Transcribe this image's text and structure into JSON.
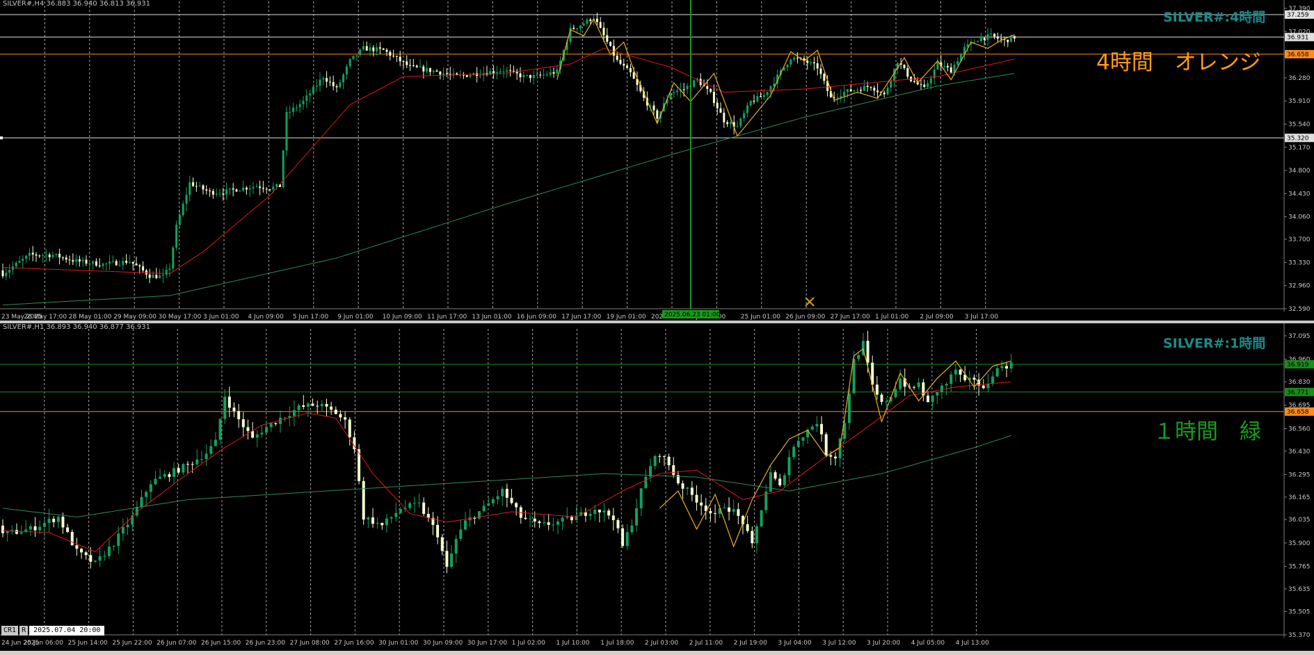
{
  "colors": {
    "bg": "#000000",
    "grid": "#d0d0d0",
    "bull": "#14a060",
    "bear": "#f5ffd0",
    "ma_red": "#e01818",
    "ma_green": "#2e8b57",
    "zigzag": "#e8b020",
    "orange_line": "#ff8c1a",
    "green_line": "#1a8c1a",
    "white_line": "#e0e0e0",
    "axis_text": "#c8c8c8",
    "watermark": "#1c8a8a",
    "note_orange": "#ff9a1a",
    "note_green": "#1a9a1a",
    "vline": "#1a9a1a",
    "cross_marker": "#d8a020"
  },
  "h4": {
    "header": "SILVER#,H4  36.883 36.940 36.813 36.931",
    "watermark": "SILVER#:4時間",
    "note": "4時間　オレンジ",
    "hlines": [
      {
        "price": 37.29,
        "label": "37.259",
        "color": "white_line"
      },
      {
        "price": 36.931,
        "label": "36.931",
        "color": "white_line"
      },
      {
        "price": 36.658,
        "label": "36.658",
        "color": "orange_line"
      },
      {
        "price": 35.32,
        "label": "35.320",
        "color": "white_line"
      }
    ],
    "vline_date_label": "2025.06.23 01:00",
    "chart_data": {
      "type": "candlestick",
      "symbol": "SILVER#",
      "timeframe": "H4",
      "ylim": [
        32.59,
        37.39
      ],
      "yticks": [
        "37.390",
        "37.020",
        "36.650",
        "36.280",
        "35.910",
        "35.540",
        "35.170",
        "34.800",
        "34.430",
        "34.060",
        "33.700",
        "33.330",
        "32.960",
        "32.590"
      ],
      "xlabels": [
        "23 May 2025",
        "26 May 17:00",
        "28 May 01:00",
        "29 May 09:00",
        "30 May 17:00",
        "3 Jun 01:00",
        "4 Jun 09:00",
        "5 Jun 17:00",
        "9 Jun 01:00",
        "10 Jun 09:00",
        "11 Jun 17:00",
        "13 Jun 01:00",
        "16 Jun 09:00",
        "17 Jun 17:00",
        "19 Jun 01:00",
        "2025.06.23 01:00",
        "Jun 17:00",
        "25 Jun 01:00",
        "26 Jun 09:00",
        "27 Jun 17:00",
        "1 Jul 01:00",
        "2 Jul 09:00",
        "3 Jul 17:00"
      ],
      "key_closes": [
        [
          0,
          33.15
        ],
        [
          8,
          33.45
        ],
        [
          15,
          33.45
        ],
        [
          22,
          33.35
        ],
        [
          30,
          33.3
        ],
        [
          38,
          33.35
        ],
        [
          44,
          33.12
        ],
        [
          48,
          33.1
        ],
        [
          50,
          33.25
        ],
        [
          52,
          33.9
        ],
        [
          56,
          34.6
        ],
        [
          62,
          34.45
        ],
        [
          66,
          34.45
        ],
        [
          70,
          34.5
        ],
        [
          76,
          34.55
        ],
        [
          80,
          34.52
        ],
        [
          83,
          34.55
        ],
        [
          85,
          35.7
        ],
        [
          90,
          35.9
        ],
        [
          96,
          36.3
        ],
        [
          100,
          36.1
        ],
        [
          104,
          36.55
        ],
        [
          108,
          36.75
        ],
        [
          114,
          36.72
        ],
        [
          122,
          36.45
        ],
        [
          130,
          36.38
        ],
        [
          136,
          36.3
        ],
        [
          142,
          36.35
        ],
        [
          150,
          36.4
        ],
        [
          156,
          36.3
        ],
        [
          160,
          36.3
        ],
        [
          166,
          36.38
        ],
        [
          170,
          37.05
        ],
        [
          174,
          37.15
        ],
        [
          177,
          37.25
        ],
        [
          180,
          36.95
        ],
        [
          184,
          36.55
        ],
        [
          188,
          36.35
        ],
        [
          192,
          35.95
        ],
        [
          196,
          35.65
        ],
        [
          200,
          36.05
        ],
        [
          204,
          36.1
        ],
        [
          208,
          36.25
        ],
        [
          212,
          36.02
        ],
        [
          216,
          35.6
        ],
        [
          220,
          35.5
        ],
        [
          224,
          35.9
        ],
        [
          228,
          36.0
        ],
        [
          232,
          36.3
        ],
        [
          236,
          36.6
        ],
        [
          240,
          36.55
        ],
        [
          244,
          36.45
        ],
        [
          248,
          35.95
        ],
        [
          252,
          36.05
        ],
        [
          256,
          36.1
        ],
        [
          260,
          36.15
        ],
        [
          264,
          36.0
        ],
        [
          268,
          36.55
        ],
        [
          272,
          36.25
        ],
        [
          276,
          36.1
        ],
        [
          280,
          36.5
        ],
        [
          284,
          36.4
        ],
        [
          288,
          36.75
        ],
        [
          292,
          36.9
        ],
        [
          296,
          36.95
        ],
        [
          300,
          36.87
        ],
        [
          303,
          36.93
        ]
      ],
      "ma_fast_sample": [
        [
          0,
          33.25
        ],
        [
          50,
          33.15
        ],
        [
          60,
          33.5
        ],
        [
          80,
          34.4
        ],
        [
          104,
          35.85
        ],
        [
          120,
          36.3
        ],
        [
          150,
          36.35
        ],
        [
          170,
          36.5
        ],
        [
          180,
          36.75
        ],
        [
          200,
          36.45
        ],
        [
          216,
          36.05
        ],
        [
          240,
          36.1
        ],
        [
          260,
          36.2
        ],
        [
          280,
          36.3
        ],
        [
          303,
          36.58
        ]
      ],
      "ma_slow_sample": [
        [
          0,
          32.65
        ],
        [
          50,
          32.8
        ],
        [
          100,
          33.4
        ],
        [
          150,
          34.25
        ],
        [
          200,
          35.05
        ],
        [
          240,
          35.65
        ],
        [
          280,
          36.15
        ],
        [
          303,
          36.35
        ]
      ],
      "zigzag": [
        [
          166,
          36.25
        ],
        [
          170,
          37.05
        ],
        [
          174,
          36.95
        ],
        [
          177,
          37.22
        ],
        [
          182,
          36.65
        ],
        [
          186,
          36.85
        ],
        [
          189,
          36.4
        ],
        [
          196,
          35.55
        ],
        [
          201,
          36.2
        ],
        [
          206,
          35.9
        ],
        [
          213,
          36.35
        ],
        [
          220,
          35.35
        ],
        [
          230,
          36.0
        ],
        [
          236,
          36.7
        ],
        [
          240,
          36.55
        ],
        [
          244,
          36.72
        ],
        [
          249,
          35.92
        ],
        [
          256,
          36.05
        ],
        [
          262,
          35.95
        ],
        [
          270,
          36.6
        ],
        [
          274,
          36.2
        ],
        [
          280,
          36.55
        ],
        [
          284,
          36.25
        ],
        [
          290,
          36.85
        ],
        [
          295,
          36.75
        ],
        [
          299,
          36.88
        ],
        [
          303,
          36.97
        ]
      ]
    }
  },
  "h1": {
    "header": "SILVER#,H1  36.893 36.940 36.877 36.931",
    "watermark": "SILVER#:1時間",
    "note": "１時間　緑",
    "hlines": [
      {
        "price": 36.931,
        "label": "36.919",
        "color": "green_line"
      },
      {
        "price": 36.771,
        "label": "36.771",
        "color": "green_line"
      },
      {
        "price": 36.658,
        "label": "36.658",
        "color": "orange_line"
      }
    ],
    "chart_data": {
      "type": "candlestick",
      "symbol": "SILVER#",
      "timeframe": "H1",
      "ylim": [
        35.37,
        37.095
      ],
      "yticks": [
        "37.095",
        "36.960",
        "36.830",
        "36.695",
        "36.560",
        "36.430",
        "36.295",
        "36.165",
        "36.035",
        "35.900",
        "35.765",
        "35.635",
        "35.505",
        "35.370"
      ],
      "xlabels": [
        "24 Jun 2025",
        "25 Jun 06:00",
        "25 Jun 14:00",
        "25 Jun 22:00",
        "26 Jun 07:00",
        "26 Jun 15:00",
        "26 Jun 23:00",
        "27 Jun 08:00",
        "27 Jun 16:00",
        "30 Jun 01:00",
        "30 Jun 09:00",
        "30 Jun 17:00",
        "1 Jul 02:00",
        "1 Jul 10:00",
        "1 Jul 18:00",
        "2 Jul 03:00",
        "2 Jul 11:00",
        "2 Jul 19:00",
        "3 Jul 04:00",
        "3 Jul 12:00",
        "3 Jul 20:00",
        "4 Jul 05:00",
        "4 Jul 13:00"
      ],
      "key_closes": [
        [
          0,
          35.95
        ],
        [
          6,
          35.98
        ],
        [
          12,
          36.05
        ],
        [
          16,
          35.85
        ],
        [
          20,
          35.78
        ],
        [
          24,
          35.9
        ],
        [
          28,
          36.05
        ],
        [
          32,
          36.25
        ],
        [
          36,
          36.3
        ],
        [
          40,
          36.35
        ],
        [
          44,
          36.42
        ],
        [
          46,
          36.48
        ],
        [
          48,
          36.75
        ],
        [
          50,
          36.65
        ],
        [
          54,
          36.5
        ],
        [
          56,
          36.55
        ],
        [
          60,
          36.62
        ],
        [
          64,
          36.68
        ],
        [
          68,
          36.7
        ],
        [
          72,
          36.65
        ],
        [
          74,
          36.6
        ],
        [
          76,
          36.45
        ],
        [
          78,
          36.05
        ],
        [
          82,
          36.0
        ],
        [
          86,
          36.1
        ],
        [
          90,
          36.12
        ],
        [
          94,
          35.95
        ],
        [
          96,
          35.75
        ],
        [
          98,
          35.92
        ],
        [
          100,
          36.02
        ],
        [
          104,
          36.1
        ],
        [
          108,
          36.2
        ],
        [
          112,
          36.05
        ],
        [
          116,
          36.0
        ],
        [
          120,
          36.02
        ],
        [
          124,
          36.05
        ],
        [
          128,
          36.1
        ],
        [
          132,
          36.05
        ],
        [
          134,
          35.88
        ],
        [
          136,
          36.02
        ],
        [
          138,
          36.2
        ],
        [
          140,
          36.35
        ],
        [
          142,
          36.42
        ],
        [
          144,
          36.35
        ],
        [
          146,
          36.25
        ],
        [
          148,
          36.2
        ],
        [
          150,
          36.15
        ],
        [
          152,
          36.1
        ],
        [
          154,
          36.05
        ],
        [
          156,
          36.12
        ],
        [
          158,
          36.08
        ],
        [
          160,
          36.02
        ],
        [
          162,
          35.88
        ],
        [
          164,
          36.1
        ],
        [
          166,
          36.3
        ],
        [
          168,
          36.22
        ],
        [
          170,
          36.4
        ],
        [
          172,
          36.5
        ],
        [
          174,
          36.55
        ],
        [
          176,
          36.6
        ],
        [
          178,
          36.42
        ],
        [
          180,
          36.4
        ],
        [
          182,
          36.6
        ],
        [
          184,
          36.95
        ],
        [
          186,
          37.05
        ],
        [
          188,
          36.8
        ],
        [
          190,
          36.7
        ],
        [
          192,
          36.75
        ],
        [
          194,
          36.85
        ],
        [
          196,
          36.78
        ],
        [
          198,
          36.82
        ],
        [
          200,
          36.7
        ],
        [
          202,
          36.78
        ],
        [
          204,
          36.82
        ],
        [
          206,
          36.9
        ],
        [
          208,
          36.82
        ],
        [
          210,
          36.85
        ],
        [
          212,
          36.78
        ],
        [
          214,
          36.88
        ],
        [
          216,
          36.92
        ],
        [
          218,
          36.93
        ]
      ],
      "ma_fast_sample": [
        [
          0,
          35.97
        ],
        [
          10,
          35.96
        ],
        [
          20,
          35.85
        ],
        [
          30,
          36.1
        ],
        [
          40,
          36.3
        ],
        [
          48,
          36.45
        ],
        [
          56,
          36.58
        ],
        [
          66,
          36.65
        ],
        [
          72,
          36.62
        ],
        [
          80,
          36.3
        ],
        [
          88,
          36.07
        ],
        [
          96,
          36.02
        ],
        [
          110,
          36.08
        ],
        [
          124,
          36.05
        ],
        [
          134,
          36.2
        ],
        [
          142,
          36.3
        ],
        [
          150,
          36.32
        ],
        [
          160,
          36.15
        ],
        [
          168,
          36.2
        ],
        [
          178,
          36.4
        ],
        [
          186,
          36.55
        ],
        [
          196,
          36.75
        ],
        [
          206,
          36.8
        ],
        [
          218,
          36.83
        ]
      ],
      "ma_slow_sample": [
        [
          0,
          36.1
        ],
        [
          16,
          36.05
        ],
        [
          40,
          36.15
        ],
        [
          70,
          36.2
        ],
        [
          100,
          36.25
        ],
        [
          130,
          36.3
        ],
        [
          150,
          36.28
        ],
        [
          170,
          36.2
        ],
        [
          190,
          36.3
        ],
        [
          210,
          36.45
        ],
        [
          218,
          36.52
        ]
      ],
      "zigzag": [
        [
          142,
          36.1
        ],
        [
          146,
          36.2
        ],
        [
          150,
          35.98
        ],
        [
          154,
          36.18
        ],
        [
          158,
          35.88
        ],
        [
          162,
          36.15
        ],
        [
          166,
          36.35
        ],
        [
          170,
          36.5
        ],
        [
          174,
          36.55
        ],
        [
          178,
          36.4
        ],
        [
          181,
          36.45
        ],
        [
          184,
          36.98
        ],
        [
          186,
          37.02
        ],
        [
          190,
          36.6
        ],
        [
          194,
          36.88
        ],
        [
          198,
          36.72
        ],
        [
          202,
          36.85
        ],
        [
          206,
          36.95
        ],
        [
          210,
          36.8
        ],
        [
          214,
          36.92
        ],
        [
          218,
          36.95
        ]
      ]
    }
  },
  "status": {
    "cr": "CR1",
    "r": "R",
    "datetime": "2025.07.04 20:00"
  }
}
